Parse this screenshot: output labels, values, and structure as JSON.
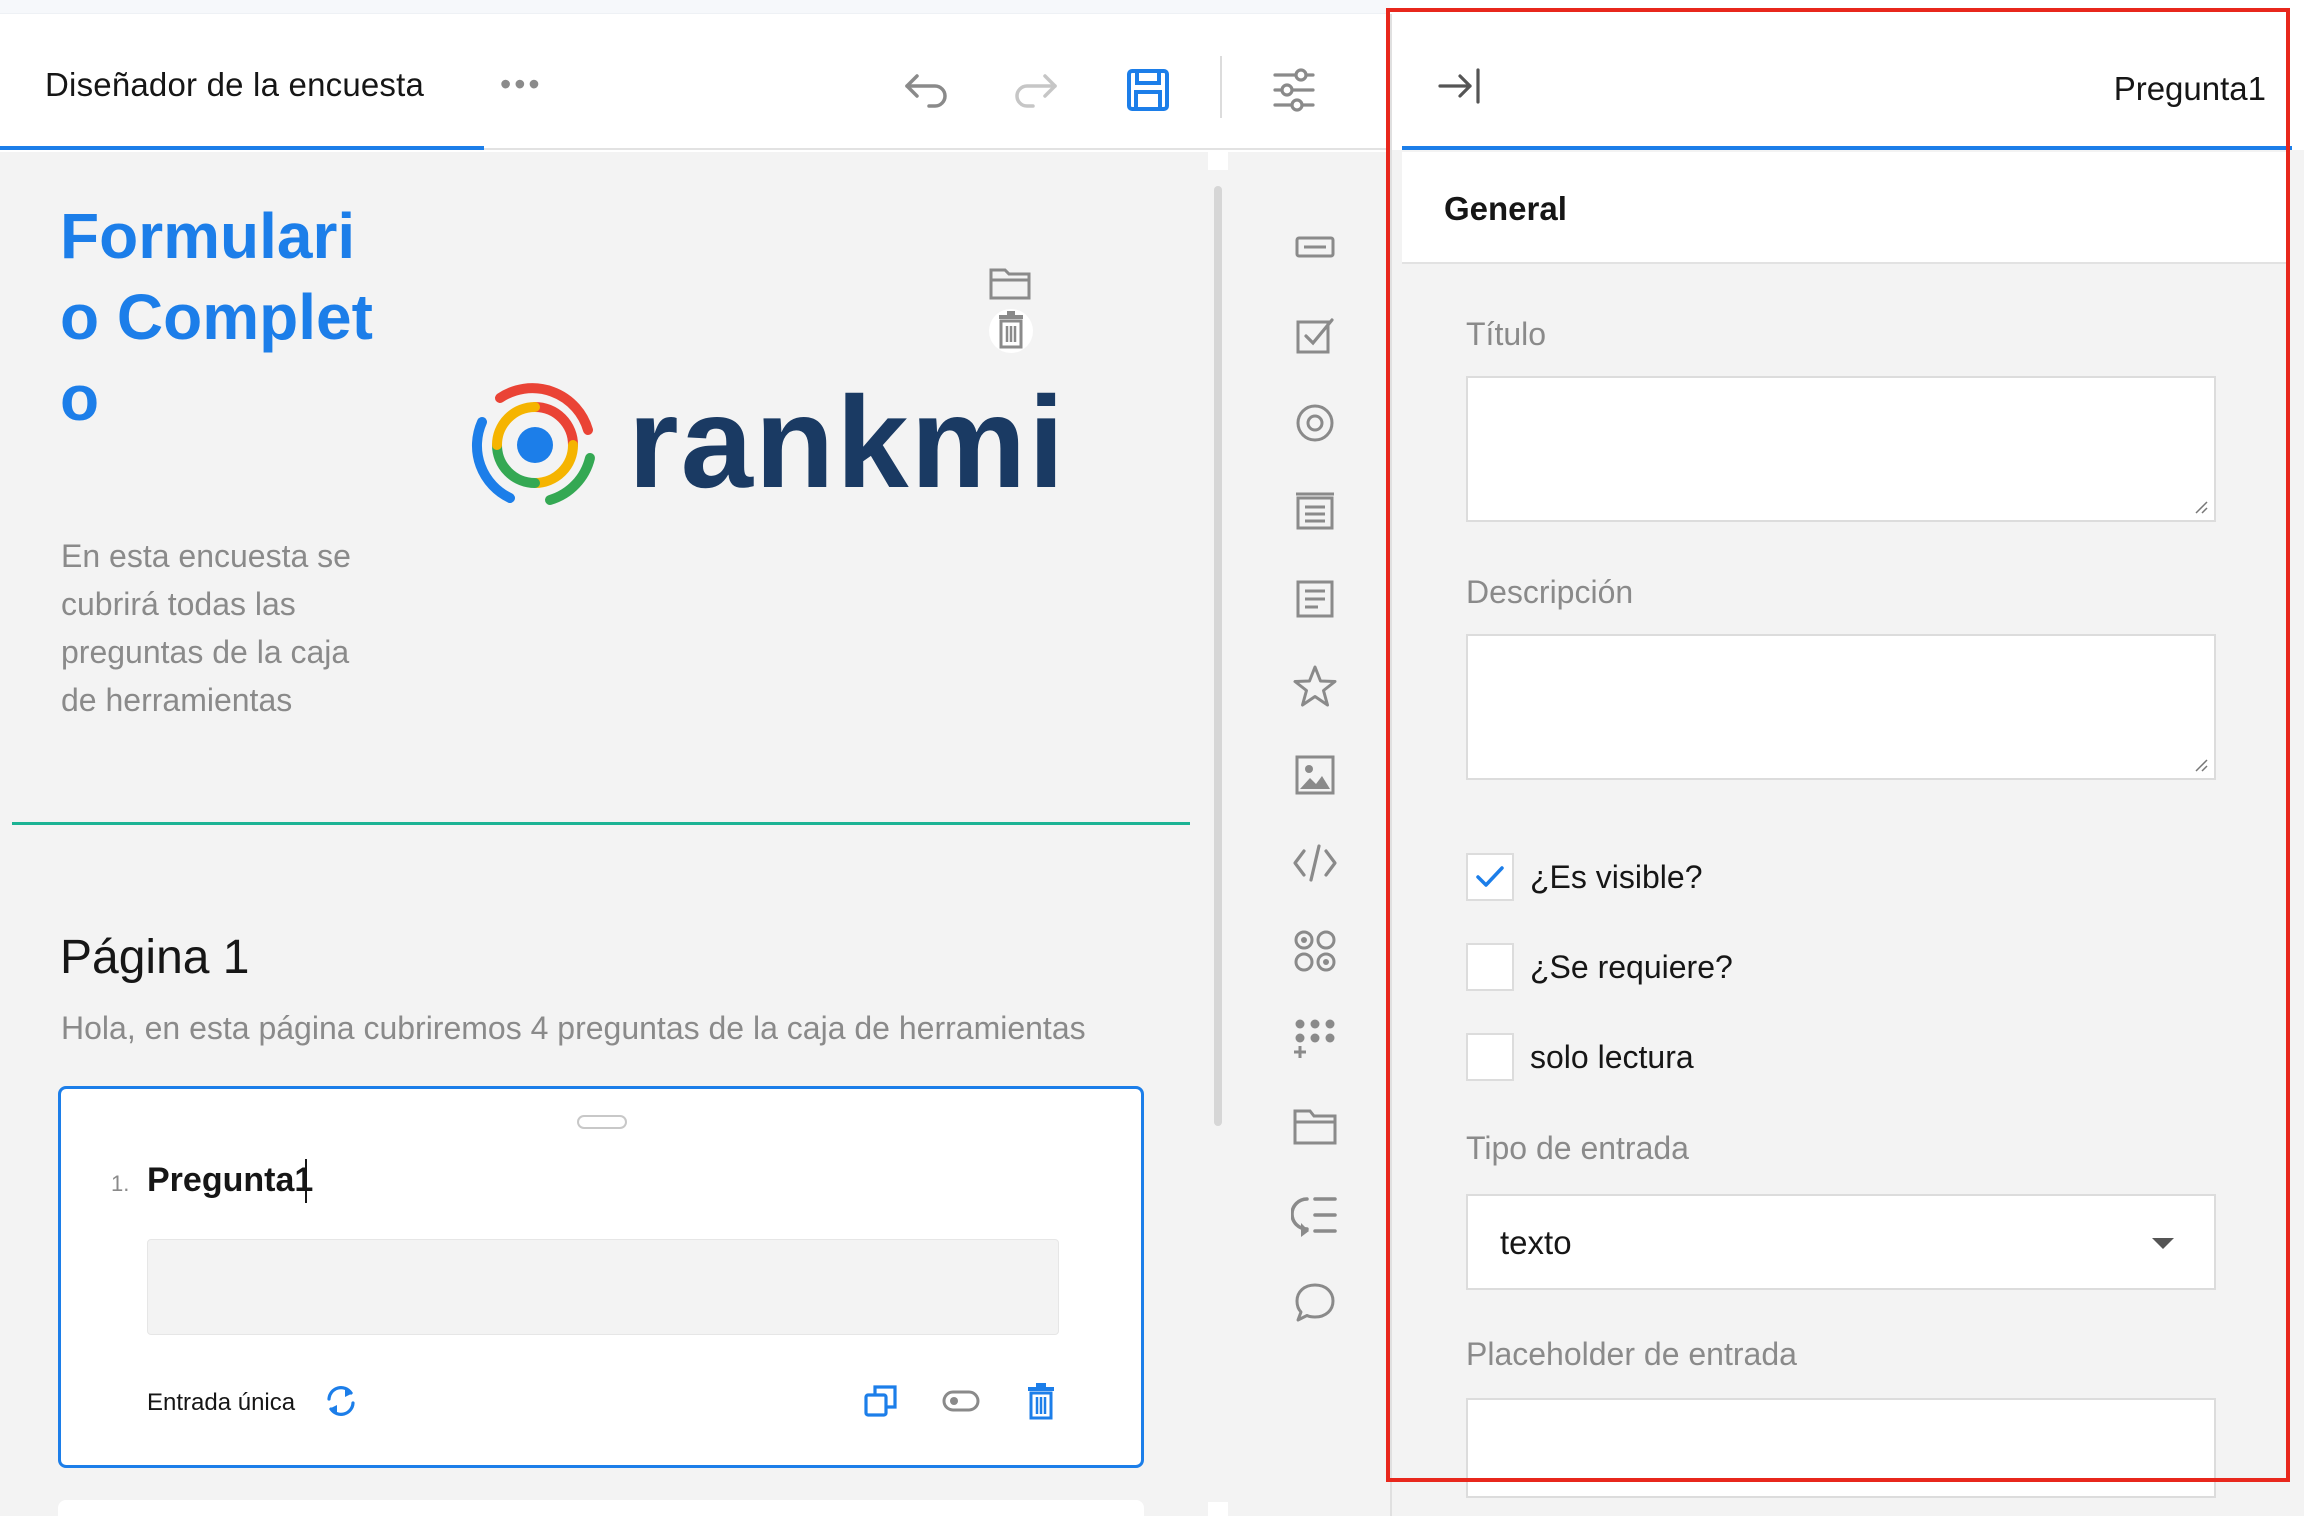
{
  "designer": {
    "tab_title": "Diseñador de la encuesta",
    "more_icon": "ellipsis-icon",
    "toolbar": {
      "undo": "undo-icon",
      "redo": "redo-icon",
      "save": "save-icon",
      "settings": "settings-sliders-icon"
    }
  },
  "survey": {
    "title": "Formulario Completo",
    "description": "En esta encuesta se cubrirá todas las preguntas de la caja de herramientas",
    "logo_text": "rankmi",
    "logo_actions": [
      "folder-icon",
      "trash-icon"
    ]
  },
  "page": {
    "title": "Página 1",
    "description": "Hola, en esta página cubriremos 4 preguntas de la caja de herramientas"
  },
  "question": {
    "number": "1.",
    "title": "Pregunta1",
    "type_label": "Entrada única",
    "actions": [
      "duplicate-icon",
      "toggle-required-icon",
      "delete-icon"
    ]
  },
  "toolbox": [
    "single-input-icon",
    "checkbox-icon",
    "radio-icon",
    "dropdown-icon",
    "comment-icon",
    "rating-icon",
    "image-icon",
    "html-icon",
    "image-picker-icon",
    "matrix-icon",
    "panel-icon",
    "paneldynamic-icon",
    "expression-icon"
  ],
  "properties": {
    "object_name": "Pregunta1",
    "collapse_icon": "collapse-panel-icon",
    "section": "General",
    "title_label": "Título",
    "title_value": "",
    "description_label": "Descripción",
    "description_value": "",
    "visible_label": "¿Es visible?",
    "visible_checked": true,
    "required_label": "¿Se requiere?",
    "required_checked": false,
    "readonly_label": "solo lectura",
    "readonly_checked": false,
    "input_type_label": "Tipo de entrada",
    "input_type_value": "texto",
    "placeholder_label": "Placeholder de entrada",
    "placeholder_value": ""
  },
  "colors": {
    "accent": "#1c7ee9",
    "divider": "#1bb394",
    "highlight_box": "#e8271c",
    "logo_text": "#1a3a63"
  }
}
